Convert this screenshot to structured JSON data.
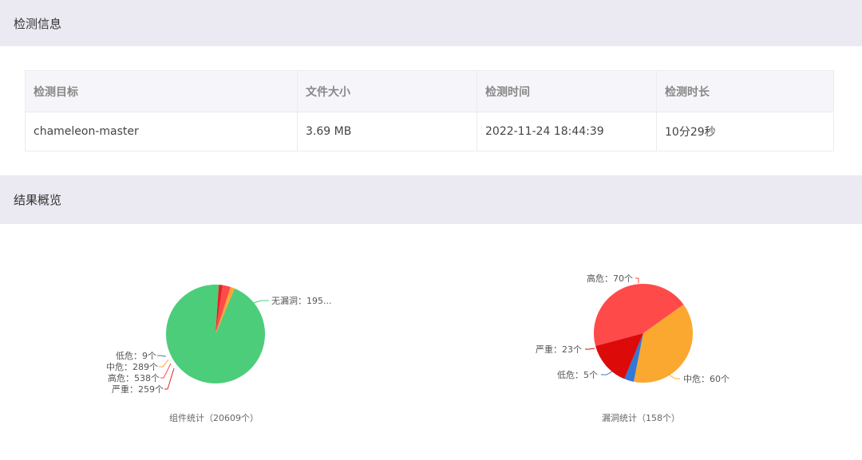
{
  "sections": {
    "info_title": "检测信息",
    "summary_title": "结果概览"
  },
  "table": {
    "headers": [
      "检测目标",
      "文件大小",
      "检测时间",
      "检测时长"
    ],
    "row": [
      "chameleon-master",
      "3.69 MB",
      "2022-11-24 18:44:39",
      "10分29秒"
    ]
  },
  "chart_data": [
    {
      "type": "pie",
      "title": "组件统计（20609个）",
      "slices": [
        {
          "name": "无漏洞",
          "value": 19514,
          "label": "无漏洞：195...",
          "color": "#4ccd7a"
        },
        {
          "name": "严重",
          "value": 259,
          "label": "严重：259个",
          "color": "#e02525"
        },
        {
          "name": "高危",
          "value": 538,
          "label": "高危：538个",
          "color": "#ff4a4a"
        },
        {
          "name": "中危",
          "value": 289,
          "label": "中危：289个",
          "color": "#fba830"
        },
        {
          "name": "低危",
          "value": 9,
          "label": "低危：9个",
          "color": "#3278d6"
        }
      ]
    },
    {
      "type": "pie",
      "title": "漏洞统计（158个）",
      "slices": [
        {
          "name": "高危",
          "value": 70,
          "label": "高危：70个",
          "color": "#ff4a4a"
        },
        {
          "name": "中危",
          "value": 60,
          "label": "中危：60个",
          "color": "#fba830"
        },
        {
          "name": "低危",
          "value": 5,
          "label": "低危：5个",
          "color": "#3278d6"
        },
        {
          "name": "严重",
          "value": 23,
          "label": "严重：23个",
          "color": "#dd0a0a"
        }
      ]
    }
  ]
}
